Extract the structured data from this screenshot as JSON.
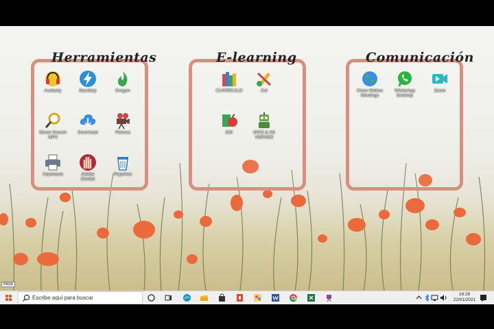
{
  "panels": [
    {
      "title": "Herramientas",
      "icons": [
        {
          "label": "Audacity",
          "icon": "headphones-icon"
        },
        {
          "label": "Bandizip",
          "icon": "lightning-icon"
        },
        {
          "label": "Dragon",
          "icon": "flame-icon"
        },
        {
          "label": "Movie Search MP3",
          "icon": "magnifier-icon"
        },
        {
          "label": "Download",
          "icon": "cloud-download-icon"
        },
        {
          "label": "Filmora",
          "icon": "video-camera-icon"
        },
        {
          "label": "Impresora",
          "icon": "printer-icon"
        },
        {
          "label": "Adobe Cenital",
          "icon": "hand-icon"
        },
        {
          "label": "Papelera",
          "icon": "trash-icon"
        }
      ]
    },
    {
      "title": "E-learning",
      "icons": [
        {
          "label": "CURRÍCULO",
          "icon": "books-icon"
        },
        {
          "label": "Cal",
          "icon": "pencil-ruler-icon"
        },
        {
          "label": "ESI",
          "icon": "apple-books-icon"
        },
        {
          "label": "INFO & AS VERNES",
          "icon": "robot-icon"
        }
      ]
    },
    {
      "title": "Comunicación",
      "icons": [
        {
          "label": "Cisco Webex Meetings",
          "icon": "globe-icon"
        },
        {
          "label": "WhatsApp Desktop",
          "icon": "whatsapp-icon"
        },
        {
          "label": "Zoom",
          "icon": "zoom-camera-icon"
        }
      ]
    }
  ],
  "taskbar": {
    "tooltip": "Inicio",
    "search_placeholder": "Escribe aquí para buscar",
    "pinned": [
      "cortana-icon",
      "task-view-icon",
      "edge-icon",
      "file-explorer-icon",
      "store-icon",
      "office-icon",
      "paint-icon",
      "word-icon",
      "chrome-icon",
      "excel-icon",
      "game-icon"
    ],
    "clock_time": "18:28",
    "clock_date": "22/01/2021"
  },
  "colors": {
    "panel_border": "#d98f80",
    "poppy": "#ea6a3c",
    "taskbar": "#f0f0f0"
  }
}
